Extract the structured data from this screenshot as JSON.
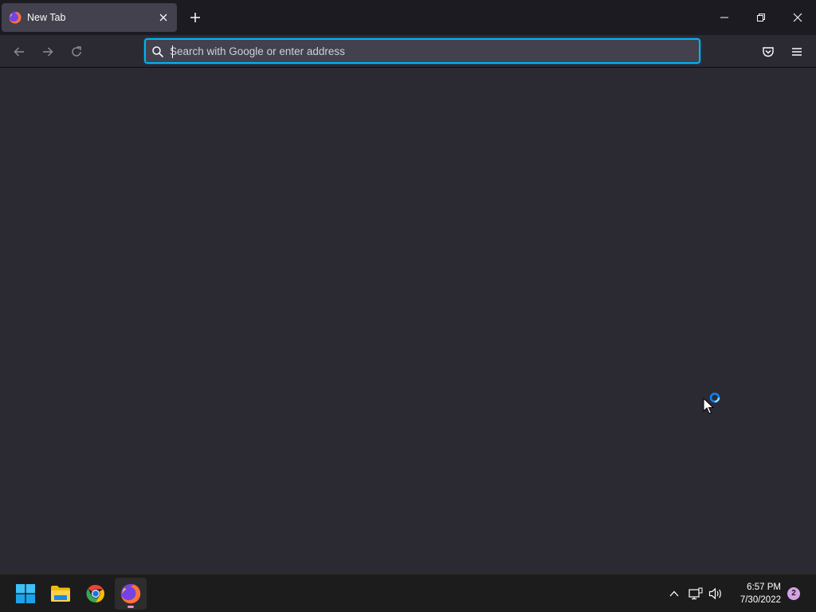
{
  "browser": {
    "tab": {
      "title": "New Tab",
      "favicon_icon": "firefox-icon",
      "close_icon": "close-icon"
    },
    "new_tab_icon": "plus-icon",
    "window_controls": [
      "minimize-icon",
      "restore-icon",
      "close-icon"
    ],
    "nav": {
      "back_icon": "arrow-left-icon",
      "forward_icon": "arrow-right-icon",
      "reload_icon": "reload-icon"
    },
    "urlbar": {
      "value": "",
      "placeholder": "Search with Google or enter address",
      "search_icon": "search-icon",
      "focus_color": "#00b3f4"
    },
    "toolbar_right": [
      "pocket-icon",
      "hamburger-menu-icon"
    ],
    "theme": {
      "content_bg": "#2b2a33",
      "frame_bg": "#1c1b22",
      "tab_bg": "#42414d"
    }
  },
  "pointer": {
    "type": "busy-arrow-cursor"
  },
  "taskbar": {
    "apps": [
      {
        "name": "Start",
        "icon": "windows-start-icon",
        "active": false
      },
      {
        "name": "File Explorer",
        "icon": "folder-icon",
        "active": false
      },
      {
        "name": "Google Chrome",
        "icon": "chrome-icon",
        "active": false
      },
      {
        "name": "Firefox",
        "icon": "firefox-icon",
        "active": true
      }
    ],
    "tray": [
      "chevron-up-icon",
      "network-icon",
      "volume-icon"
    ],
    "clock": {
      "time": "6:57 PM",
      "date": "7/30/2022"
    },
    "notifications": "2"
  }
}
